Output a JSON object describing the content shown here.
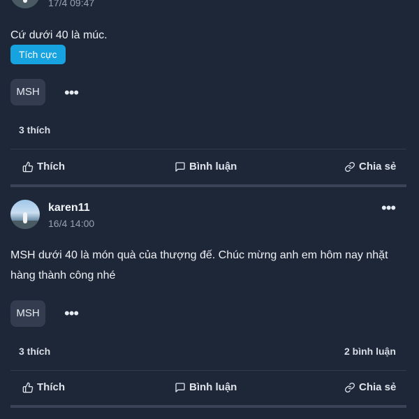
{
  "posts": [
    {
      "username": "",
      "timestamp": "17/4 09:47",
      "content": "Cứ dưới 40 là múc.",
      "sentiment": "Tích cực",
      "ticker": "MSH",
      "likes": "3 thích",
      "comments": "",
      "actions": {
        "like": "Thích",
        "comment": "Bình luận",
        "share": "Chia sẻ"
      }
    },
    {
      "username": "karen11",
      "timestamp": "16/4 14:00",
      "content": "MSH dưới 40 là món quà của thượng đế. Chúc mừng anh em hôm nay nhặt hàng thành công nhé",
      "sentiment": "",
      "ticker": "MSH",
      "likes": "3 thích",
      "comments": "2 bình luận",
      "actions": {
        "like": "Thích",
        "comment": "Bình luận",
        "share": "Chia sẻ"
      }
    }
  ],
  "more_glyph": "•••",
  "colors": {
    "background": "#1e2738",
    "badge": "#17a3e0",
    "chip": "#333d4f",
    "divider": "#323c4d"
  },
  "icons": [
    "thumbs-up-icon",
    "comment-icon",
    "link-icon",
    "more-icon"
  ]
}
